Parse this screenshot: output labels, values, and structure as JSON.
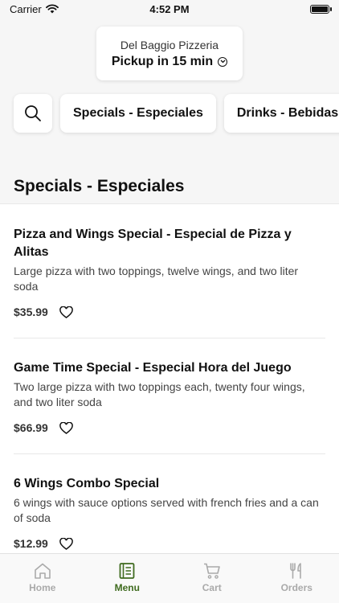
{
  "status_bar": {
    "carrier": "Carrier",
    "time": "4:52 PM"
  },
  "store": {
    "name": "Del Baggio Pizzeria",
    "pickup": "Pickup in 15 min"
  },
  "categories": [
    "Specials - Especiales",
    "Drinks - Bebidas"
  ],
  "section": {
    "title": "Specials - Especiales"
  },
  "items": [
    {
      "name": "Pizza and Wings Special - Especial de Pizza y Alitas",
      "description": "Large pizza with two toppings, twelve wings, and two liter soda",
      "price": "$35.99"
    },
    {
      "name": "Game Time Special - Especial Hora del Juego",
      "description": "Two large pizza with two toppings each, twenty four wings, and two liter soda",
      "price": "$66.99"
    },
    {
      "name": "6 Wings Combo Special",
      "description": "6 wings with sauce options served with french fries and a can of soda",
      "price": "$12.99"
    }
  ],
  "tabs": [
    {
      "label": "Home",
      "icon": "home-icon"
    },
    {
      "label": "Menu",
      "icon": "menu-icon"
    },
    {
      "label": "Cart",
      "icon": "cart-icon"
    },
    {
      "label": "Orders",
      "icon": "orders-icon"
    }
  ],
  "active_tab": "Menu",
  "colors": {
    "accent": "#3f6b1f",
    "inactive": "#aaaaaa"
  }
}
